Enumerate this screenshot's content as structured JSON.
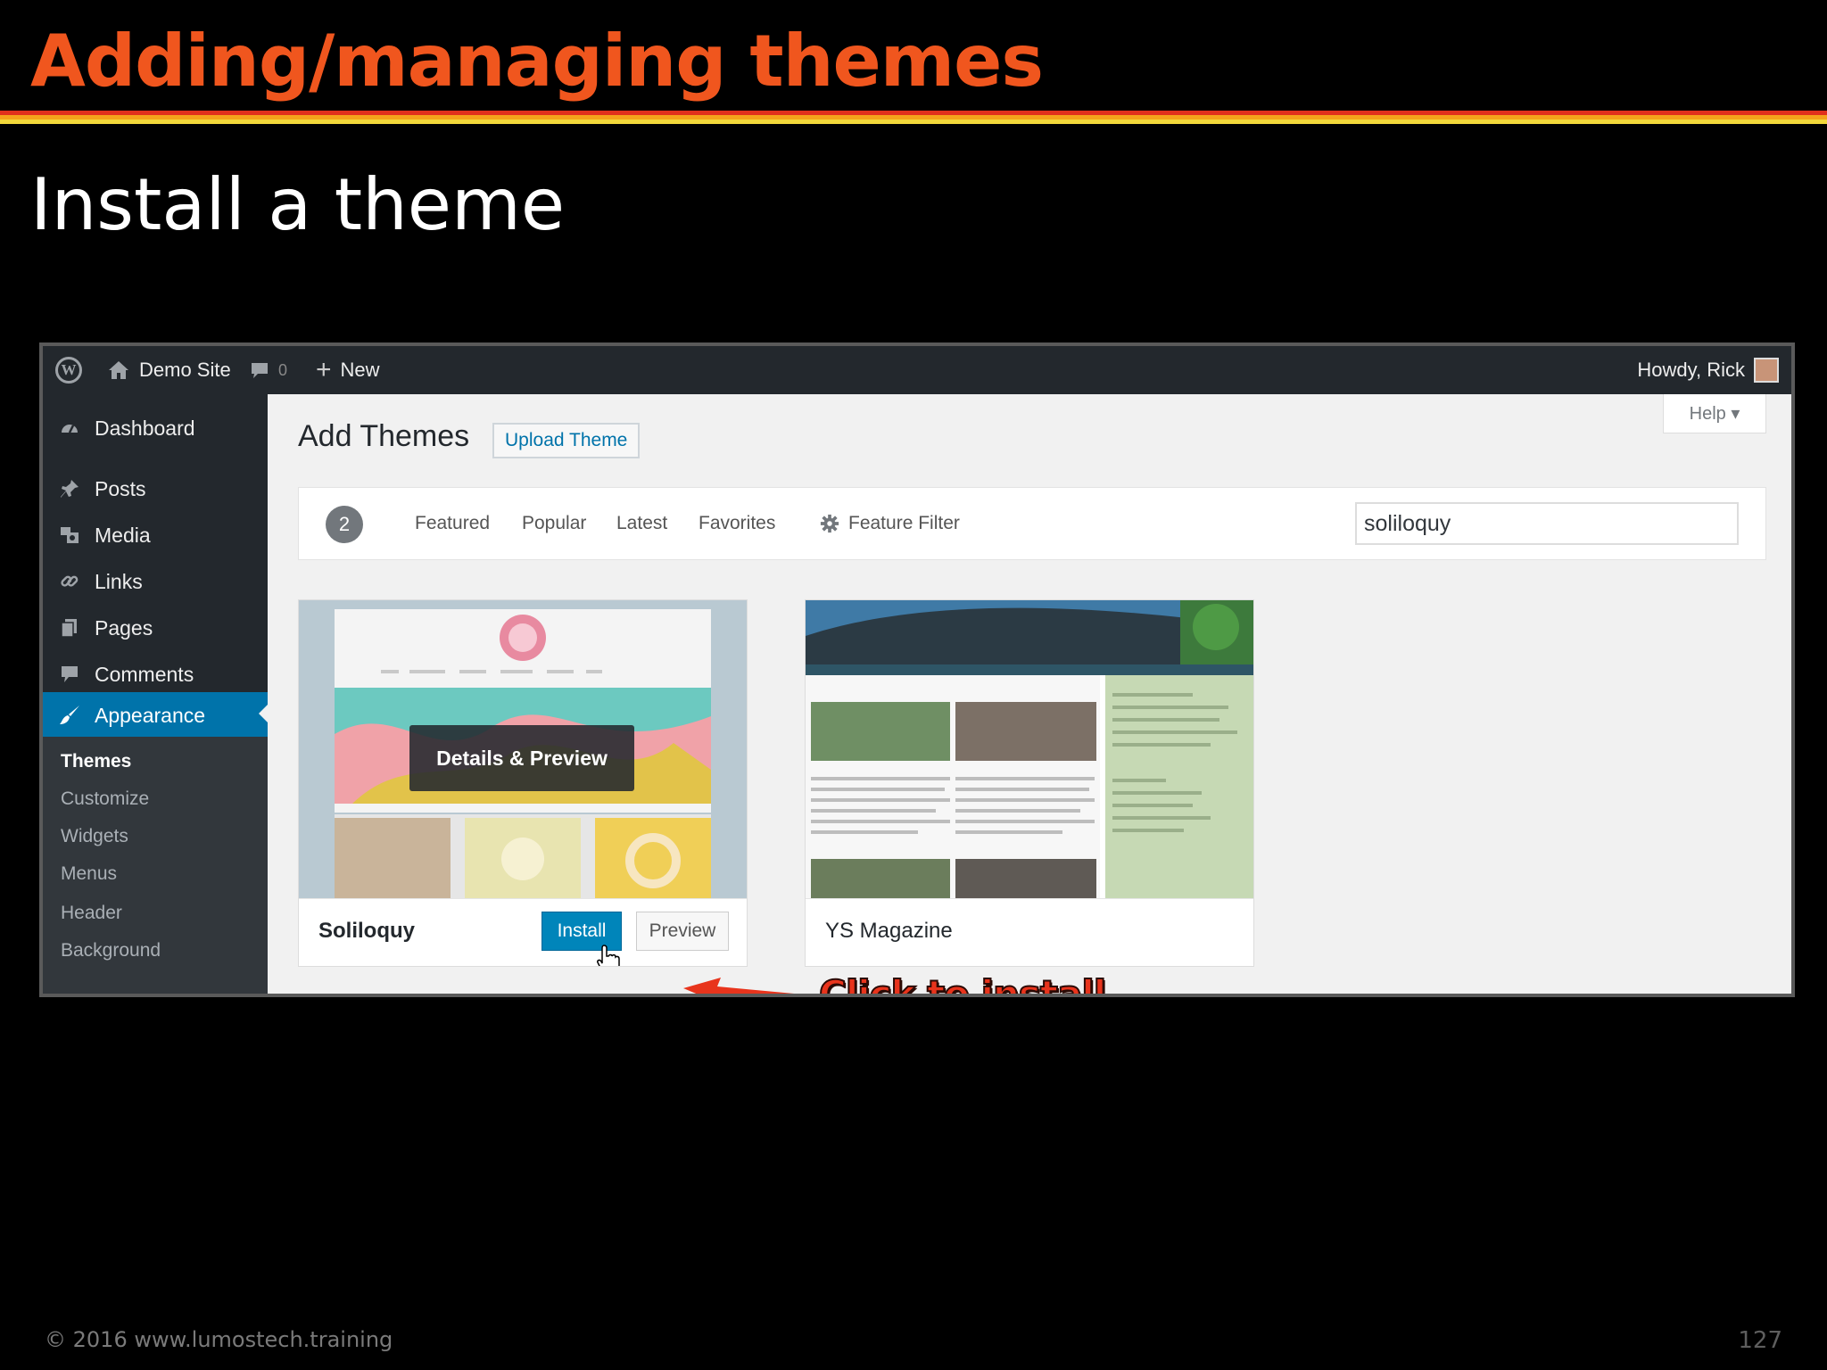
{
  "slide": {
    "title": "Adding/managing themes",
    "subtitle": "Install a theme",
    "footer_left": "© 2016  www.lumostech.training",
    "page_number": "127"
  },
  "colors": {
    "title_orange": "#f0561e",
    "wp_blue": "#0073aa",
    "admin_dark": "#23282d",
    "annotation_red": "#e8341c"
  },
  "adminbar": {
    "logo_icon": "wordpress-logo-icon",
    "site_name": "Demo Site",
    "comments_count": "0",
    "new_label": "New",
    "greeting": "Howdy, Rick"
  },
  "sidebar": {
    "items": [
      {
        "label": "Dashboard",
        "icon": "dashboard-icon"
      },
      {
        "label": "Posts",
        "icon": "pin-icon"
      },
      {
        "label": "Media",
        "icon": "media-icon"
      },
      {
        "label": "Links",
        "icon": "link-icon"
      },
      {
        "label": "Pages",
        "icon": "pages-icon"
      },
      {
        "label": "Comments",
        "icon": "comment-icon"
      },
      {
        "label": "Appearance",
        "icon": "brush-icon"
      }
    ],
    "submenu": [
      "Themes",
      "Customize",
      "Widgets",
      "Menus",
      "Header",
      "Background"
    ]
  },
  "main": {
    "title": "Add Themes",
    "upload_button": "Upload Theme",
    "help_label": "Help ▾",
    "filter": {
      "count": "2",
      "links": [
        "Featured",
        "Popular",
        "Latest",
        "Favorites"
      ],
      "feature_filter": "Feature Filter",
      "search_value": "soliloquy"
    },
    "themes": [
      {
        "name": "Soliloquy",
        "overlay_label": "Details & Preview",
        "install_label": "Install",
        "preview_label": "Preview"
      },
      {
        "name": "YS Magazine"
      }
    ]
  },
  "annotation": {
    "text": "Click to install"
  }
}
